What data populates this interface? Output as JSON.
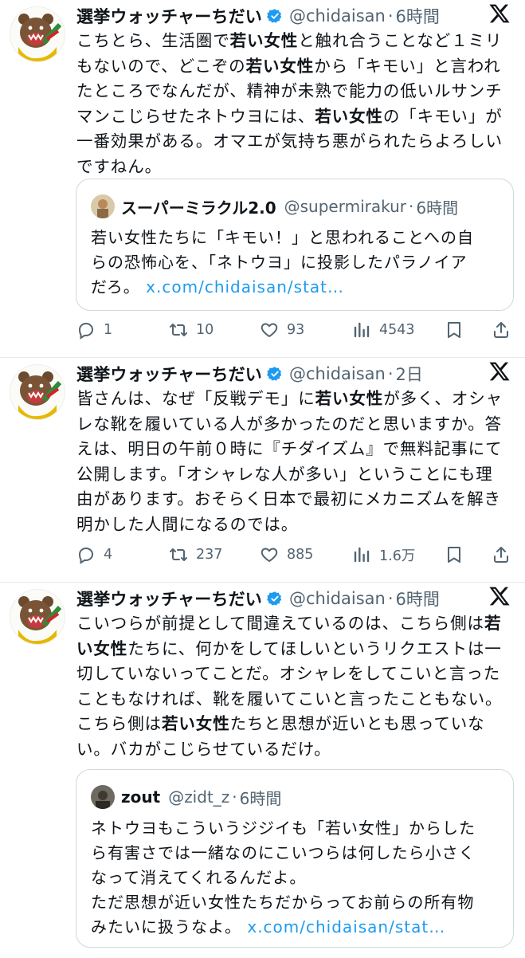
{
  "tweets": [
    {
      "author": {
        "name": "選挙ウォッチャーちだい",
        "handle": "@chidaisan",
        "time": "6時間"
      },
      "lines": [
        [
          {
            "t": "こちとら、生活圏で"
          },
          {
            "t": "若い女性",
            "b": true
          },
          {
            "t": "と触れ合うことなど１ミリ"
          }
        ],
        [
          {
            "t": "もないので、どこぞの"
          },
          {
            "t": "若い女性",
            "b": true
          },
          {
            "t": "から「キモい」と言われ"
          }
        ],
        [
          {
            "t": "たところでなんだが、精神が未熟で能力の低いルサンチ"
          }
        ],
        [
          {
            "t": "マンこじらせたネトウヨには、"
          },
          {
            "t": "若い女性",
            "b": true
          },
          {
            "t": "の「キモい」が"
          }
        ],
        [
          {
            "t": "一番効果がある。オマエが気持ち悪がられたらよろしい"
          }
        ],
        [
          {
            "t": "ですねん。"
          }
        ]
      ],
      "quote": {
        "name": "スーパーミラクル2.0",
        "handle": "@supermirakur",
        "time": "6時間",
        "lines": [
          [
            {
              "t": "若い女性たちに「キモい！」と思われることへの自"
            }
          ],
          [
            {
              "t": "らの恐怖心を、「ネトウヨ」に投影したパラノイア"
            }
          ],
          [
            {
              "t": "だろ。 "
            },
            {
              "t": "x.com/chidaisan/stat…",
              "link": true
            }
          ]
        ]
      },
      "stats": {
        "replies": "1",
        "retweets": "10",
        "likes": "93",
        "views": "4543"
      }
    },
    {
      "author": {
        "name": "選挙ウォッチャーちだい",
        "handle": "@chidaisan",
        "time": "2日"
      },
      "lines": [
        [
          {
            "t": "皆さんは、なぜ「反戦デモ」に"
          },
          {
            "t": "若い女性",
            "b": true
          },
          {
            "t": "が多く、オシャ"
          }
        ],
        [
          {
            "t": "レな靴を履いている人が多かったのだと思いますか。答"
          }
        ],
        [
          {
            "t": "えは、明日の午前０時に『チダイズム』で無料記事にて"
          }
        ],
        [
          {
            "t": "公開します。「オシャレな人が多い」ということにも理"
          }
        ],
        [
          {
            "t": "由があります。おそらく日本で最初にメカニズムを解き"
          }
        ],
        [
          {
            "t": "明かした人間になるのでは。"
          }
        ]
      ],
      "stats": {
        "replies": "4",
        "retweets": "237",
        "likes": "885",
        "views": "1.6万"
      }
    },
    {
      "author": {
        "name": "選挙ウォッチャーちだい",
        "handle": "@chidaisan",
        "time": "6時間"
      },
      "lines": [
        [
          {
            "t": "こいつらが前提として間違えているのは、こちら側は"
          },
          {
            "t": "若",
            "b": true
          }
        ],
        [
          {
            "t": "い女性",
            "b": true
          },
          {
            "t": "たちに、何かをしてほしいというリクエストは一"
          }
        ],
        [
          {
            "t": "切していないってことだ。オシャレをしてこいと言った"
          }
        ],
        [
          {
            "t": "こともなければ、靴を履いてこいと言ったこともない。"
          }
        ],
        [
          {
            "t": "こちら側は"
          },
          {
            "t": "若い女性",
            "b": true
          },
          {
            "t": "たちと思想が近いとも思っていな"
          }
        ],
        [
          {
            "t": "い。バカがこじらせているだけ。"
          }
        ]
      ],
      "quote": {
        "name": "zout",
        "handle": "@zidt_z",
        "time": "6時間",
        "lines": [
          [
            {
              "t": "ネトウヨもこういうジジイも「若い女性」からした"
            }
          ],
          [
            {
              "t": "ら有害さでは一緒なのにこいつらは何したら小さく"
            }
          ],
          [
            {
              "t": "なって消えてくれるんだよ。"
            }
          ],
          [
            {
              "t": "ただ思想が近い女性たちだからってお前らの所有物"
            }
          ],
          [
            {
              "t": "みたいに扱うなよ。 "
            },
            {
              "t": "x.com/chidaisan/stat…",
              "link": true
            }
          ]
        ]
      }
    }
  ],
  "icons": {
    "avatar": "bear-mascot-avatar",
    "verified": "verified-badge-icon",
    "logo": "x-logo-icon",
    "reply": "reply-icon",
    "retweet": "retweet-icon",
    "like": "heart-icon",
    "views": "views-chart-icon",
    "bookmark": "bookmark-icon",
    "share": "share-icon"
  },
  "colors": {
    "accent": "#1d9bf0",
    "muted": "#536471",
    "text": "#0f1419",
    "border": "#cfd9de"
  }
}
